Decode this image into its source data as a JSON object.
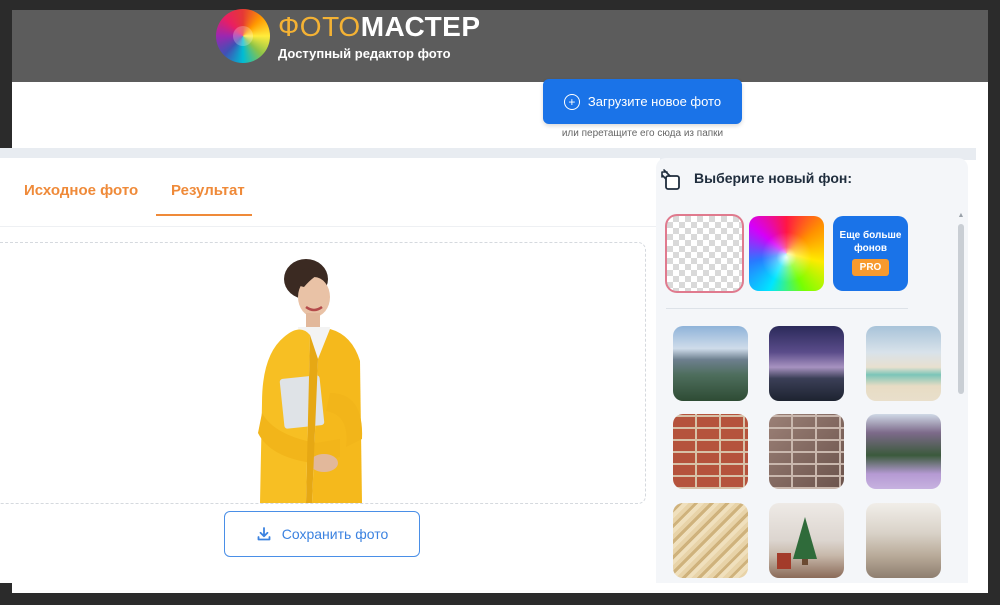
{
  "header": {
    "brand_part1": "ФОТО",
    "brand_part2": "МАСТЕР",
    "tagline": "Доступный редактор фото",
    "logo_icon": "rainbow-lens-logo-icon"
  },
  "upload": {
    "button_label": "Загрузите новое фото",
    "hint": "или перетащите его сюда из папки",
    "icon": "plus-circle-icon"
  },
  "tabs": [
    {
      "label": "Исходное фото",
      "active": false
    },
    {
      "label": "Результат",
      "active": true
    }
  ],
  "canvas": {
    "content": "woman-in-yellow-jacket-cutout"
  },
  "save": {
    "button_label": "Сохранить фото",
    "icon": "download-icon"
  },
  "side_panel": {
    "title": "Выберите новый фон:",
    "title_icon": "layers-icon",
    "more_tile": {
      "label": "Еще больше фонов",
      "badge": "PRO"
    },
    "backgrounds": [
      {
        "name": "transparent",
        "selected": true
      },
      {
        "name": "rainbow-gradient"
      },
      {
        "name": "mountain-lake"
      },
      {
        "name": "starry-mountains"
      },
      {
        "name": "tropical-beach"
      },
      {
        "name": "red-brick-wall"
      },
      {
        "name": "grey-brick-wall"
      },
      {
        "name": "blooming-alley"
      },
      {
        "name": "wheat-field"
      },
      {
        "name": "christmas-living-room"
      },
      {
        "name": "bright-living-room"
      }
    ]
  },
  "colors": {
    "header_bg": "#5c5c5c",
    "accent_blue": "#1a73e8",
    "tab_orange": "#ef8a39",
    "pro_orange": "#f79a2e"
  }
}
